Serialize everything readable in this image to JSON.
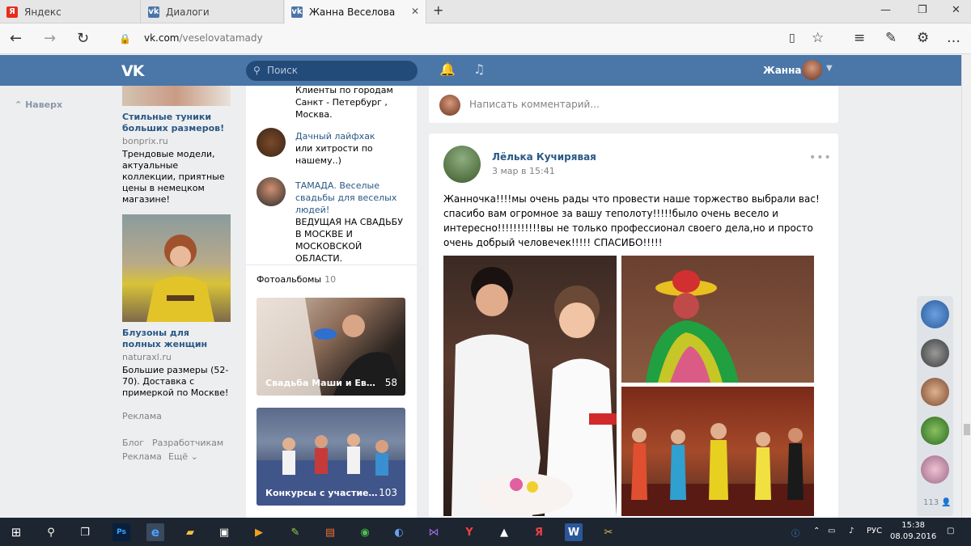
{
  "browser": {
    "tabs": [
      {
        "label": "Яндекс",
        "icon": "yandex-icon"
      },
      {
        "label": "Диалоги",
        "icon": "vk-icon"
      },
      {
        "label": "Жанна Веселова",
        "icon": "vk-icon"
      }
    ],
    "url_domain": "vk.com",
    "url_path": "/veselovatamady"
  },
  "header": {
    "search_placeholder": "Поиск",
    "user_name": "Жанна",
    "accent": "#4a76a8"
  },
  "left": {
    "back_to_top": "Наверх",
    "ads": [
      {
        "title": "Стильные туники больших размеров!",
        "domain": "bonprix.ru",
        "desc": "Трендовые модели, актуальные коллекции, приятные цены в немецком магазине!"
      },
      {
        "title": "Блузоны для полных женщин",
        "domain": "naturaxl.ru",
        "desc": "Большие размеры (52-70). Доставка с примеркой по Москве!"
      }
    ],
    "ads_label": "Реклама",
    "footer_blog": "Блог",
    "footer_dev": "Разработчикам",
    "footer_ads": "Реклама",
    "footer_more": "Ещё"
  },
  "groups": {
    "g0_desc": "Клиенты по городам Санкт - Петербург , Москва.",
    "g1_title": "Дачный лайфхак",
    "g1_desc": "или хитрости по нашему..)",
    "g2_title": "ТАМАДА. Веселые свадьбы для веселых людей!",
    "g2_desc": "ВЕДУЩАЯ НА СВАДЬБУ В МОСКВЕ И МОСКОВСКОЙ ОБЛАСТИ."
  },
  "albums": {
    "title": "Фотоальбомы",
    "count": "10",
    "items": [
      {
        "name": "Свадьба Маши и Евгения",
        "count": "58"
      },
      {
        "name": "Конкурсы с участием г...",
        "count": "103"
      }
    ]
  },
  "comment": {
    "placeholder": "Написать комментарий..."
  },
  "post": {
    "author": "Лёлька Кучирявая",
    "date": "3 мар в 15:41",
    "text": "Жанночка!!!!мы очень рады что провести наше торжество выбрали вас!спасибо вам огромное за вашу теполоту!!!!!было очень весело и интересно!!!!!!!!!!!вы не только профессионал своего дела,но и просто очень добрый человечек!!!!! СПАСИБО!!!!!"
  },
  "side": {
    "online_count": "113"
  },
  "taskbar": {
    "lang": "РУС",
    "time": "15:38",
    "date": "08.09.2016"
  }
}
